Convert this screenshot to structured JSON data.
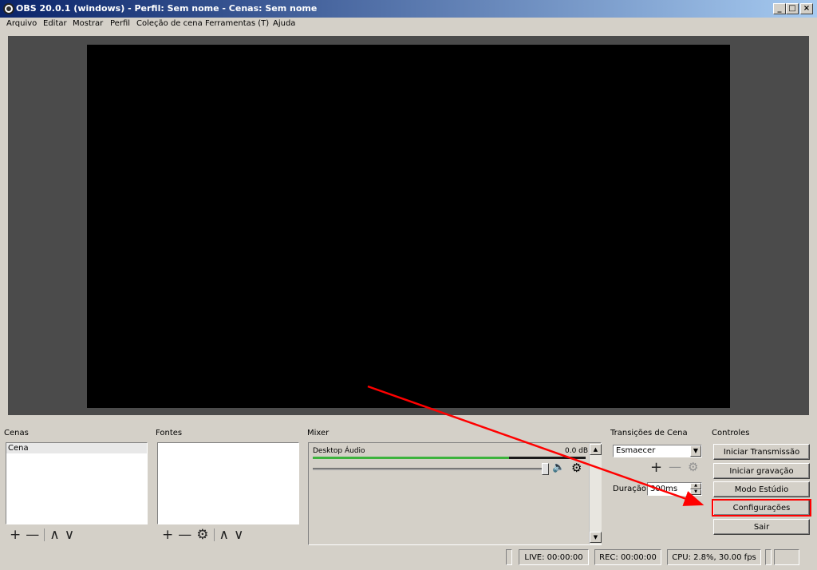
{
  "window": {
    "title": "OBS 20.0.1 (windows) - Perfil: Sem nome - Cenas: Sem nome",
    "minimize_label": "_",
    "maximize_label": "□",
    "close_label": "×"
  },
  "menu": {
    "items": [
      "Arquivo",
      "Editar",
      "Mostrar",
      "Perfil",
      "Coleção de cena",
      "Ferramentas (T)",
      "Ajuda"
    ]
  },
  "docks": {
    "scenes": {
      "label": "Cenas",
      "items": [
        {
          "label": "Cena",
          "selected": true
        }
      ]
    },
    "sources": {
      "label": "Fontes",
      "items": []
    },
    "mixer": {
      "label": "Mixer",
      "channels": [
        {
          "name": "Desktop Áudio",
          "db": "0.0 dB",
          "level": 0.72,
          "volume": 1.0
        }
      ]
    },
    "transitions": {
      "label": "Transições de Cena",
      "selected": "Esmaecer",
      "duration_label": "Duração",
      "duration_value": "300ms"
    },
    "controls": {
      "label": "Controles",
      "buttons": [
        "Iniciar Transmissão",
        "Iniciar gravação",
        "Modo Estúdio",
        "Configurações",
        "Sair"
      ]
    }
  },
  "icons": {
    "add": "+",
    "remove": "—",
    "up": "∧",
    "down": "∨",
    "gear": "⚙",
    "speaker": "🔈",
    "dropdown": "▼",
    "scroll_up": "▲",
    "scroll_down": "▼"
  },
  "status": {
    "live": "LIVE: 00:00:00",
    "rec": "REC: 00:00:00",
    "cpu": "CPU: 2.8%, 30.00 fps"
  },
  "colors": {
    "preview_bg": "#4b4b4b",
    "canvas": "#000000",
    "meter_green": "#3db33d",
    "annotation_red": "#ff0000"
  }
}
